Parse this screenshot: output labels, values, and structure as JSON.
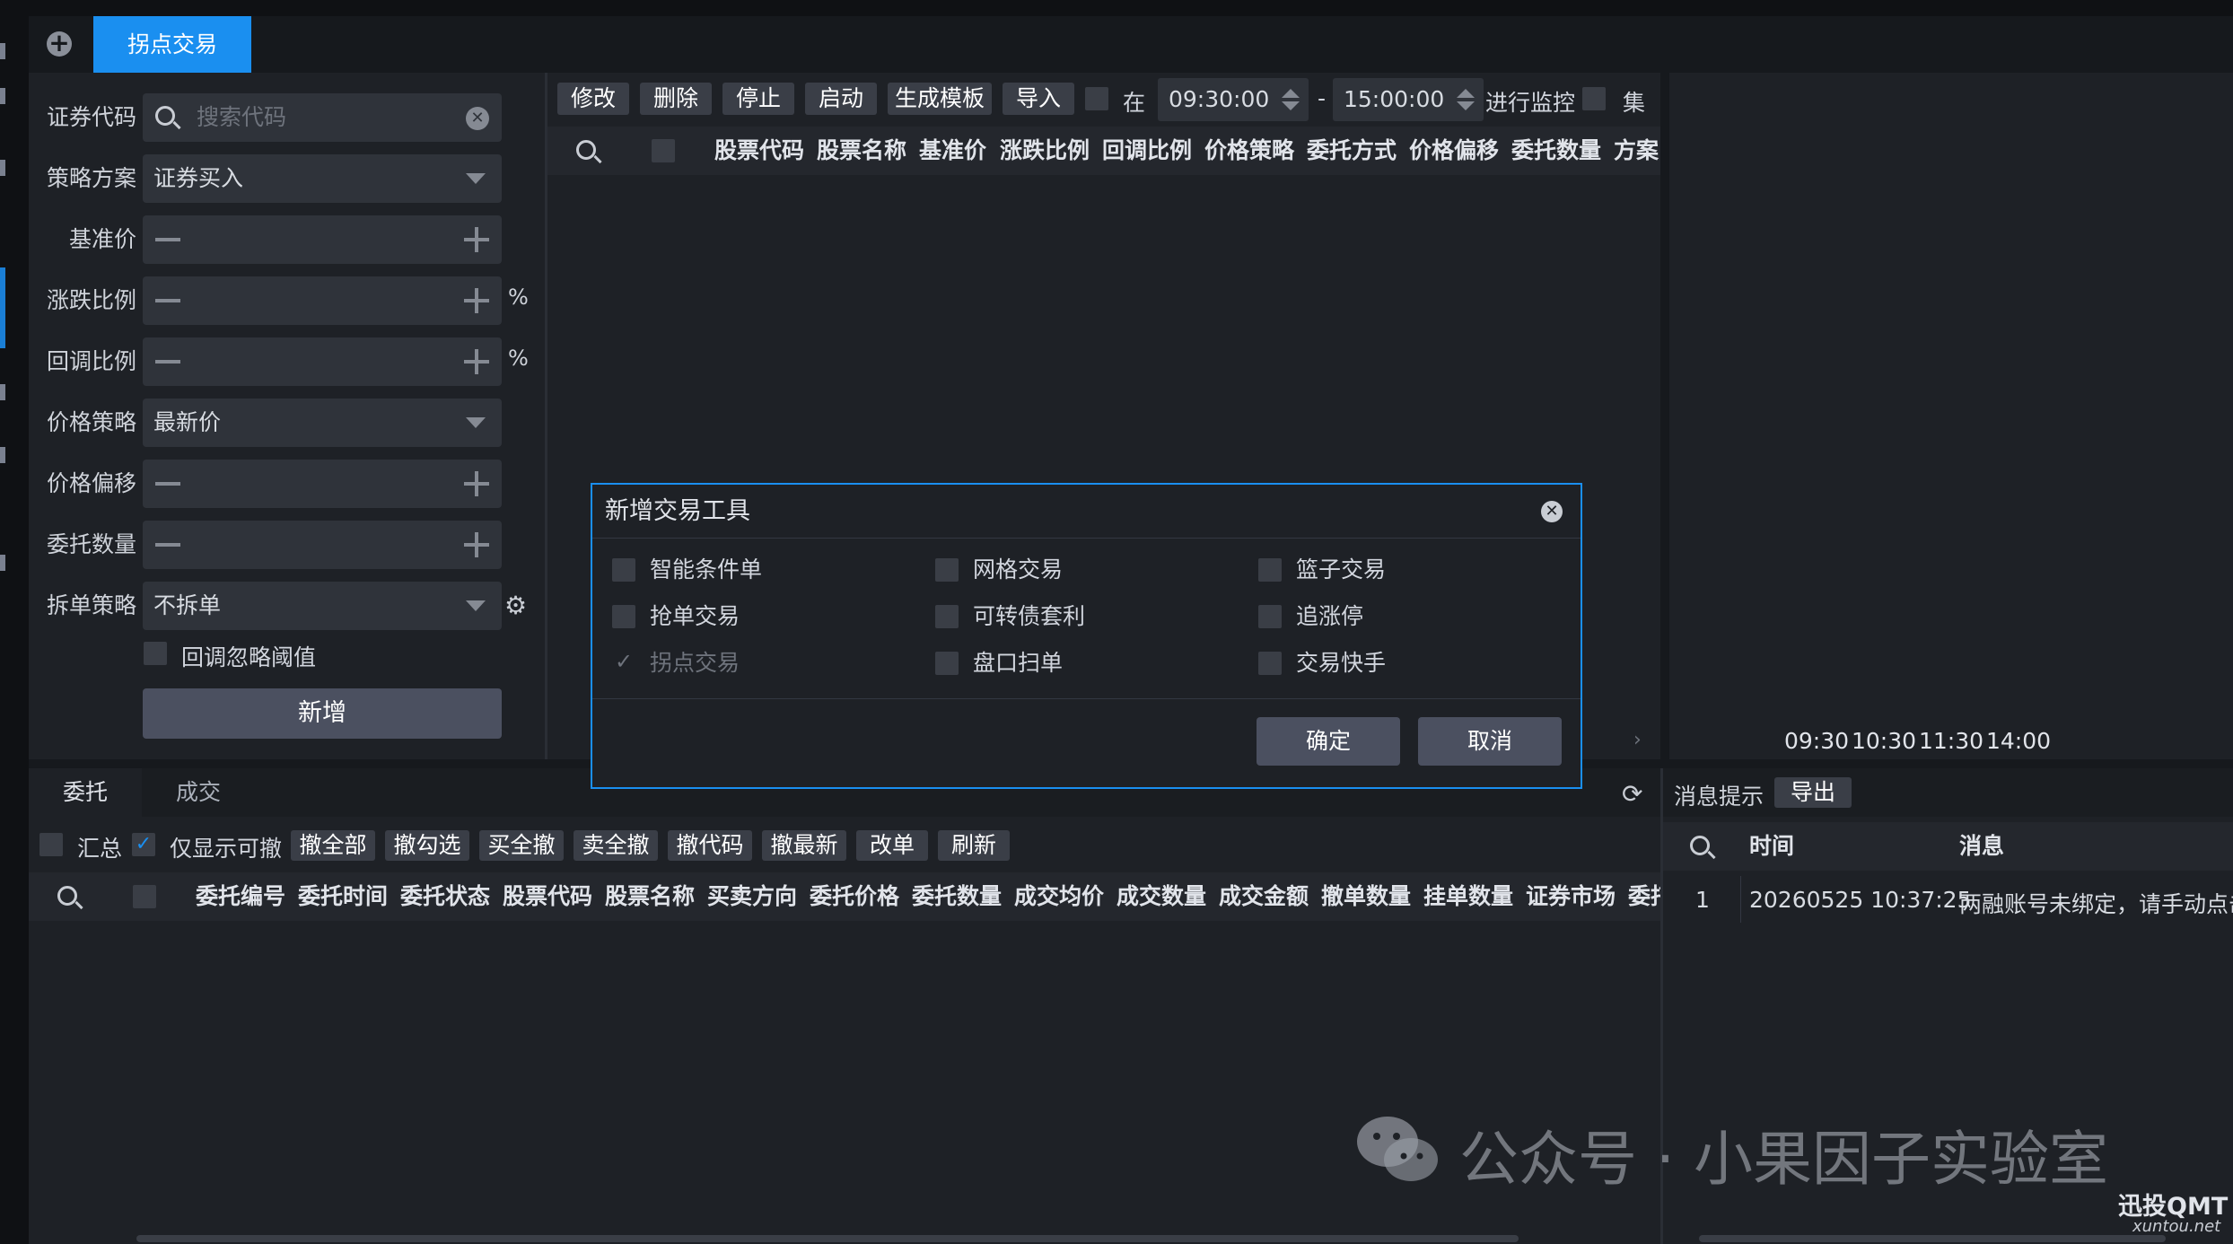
{
  "tabs": {
    "active": "拐点交易"
  },
  "form": {
    "security_code": {
      "label": "证券代码",
      "placeholder": "搜索代码"
    },
    "strategy_plan": {
      "label": "策略方案",
      "value": "证券买入"
    },
    "base_price": {
      "label": "基准价"
    },
    "change_ratio": {
      "label": "涨跌比例",
      "unit": "%"
    },
    "pullback_ratio": {
      "label": "回调比例",
      "unit": "%"
    },
    "price_strategy": {
      "label": "价格策略",
      "value": "最新价"
    },
    "price_offset": {
      "label": "价格偏移"
    },
    "order_qty": {
      "label": "委托数量"
    },
    "split_strategy": {
      "label": "拆单策略",
      "value": "不拆单"
    },
    "ignore_threshold": "回调忽略阈值",
    "add_button": "新增"
  },
  "toolbar": {
    "buttons": [
      "修改",
      "删除",
      "停止",
      "启动",
      "生成模板",
      "导入"
    ],
    "at_label": "在",
    "start_time": "09:30:00",
    "dash": "-",
    "end_time": "15:00:00",
    "monitor_label": "进行监控",
    "collect_label": "集"
  },
  "top_table": {
    "columns": [
      "股票代码",
      "股票名称",
      "基准价",
      "涨跌比例",
      "回调比例",
      "价格策略",
      "委托方式",
      "价格偏移",
      "委托数量",
      "方案"
    ]
  },
  "right_chart": {
    "time_axis": [
      "09:30",
      "10:30",
      "11:30",
      "14:00"
    ]
  },
  "dialog": {
    "title": "新增交易工具",
    "options": [
      [
        "智能条件单",
        "网格交易",
        "篮子交易"
      ],
      [
        "抢单交易",
        "可转债套利",
        "追涨停"
      ],
      [
        "拐点交易",
        "盘口扫单",
        "交易快手"
      ]
    ],
    "confirm": "确定",
    "cancel": "取消"
  },
  "bottom": {
    "tabs": [
      "委托",
      "成交"
    ],
    "summary_label": "汇总",
    "cancellable_only_label": "仅显示可撤",
    "actions": [
      "撤全部",
      "撤勾选",
      "买全撤",
      "卖全撤",
      "撤代码",
      "撤最新",
      "改单",
      "刷新"
    ],
    "columns": [
      "委托编号",
      "委托时间",
      "委托状态",
      "股票代码",
      "股票名称",
      "买卖方向",
      "委托价格",
      "委托数量",
      "成交均价",
      "成交数量",
      "成交金额",
      "撤单数量",
      "挂单数量",
      "证券市场",
      "委托"
    ]
  },
  "messages": {
    "title": "消息提示",
    "export": "导出",
    "columns": [
      "时间",
      "消息"
    ],
    "rows": [
      {
        "index": "1",
        "time": "20260525 10:37:25",
        "message": "两融账号未绑定，请手动点击"
      }
    ]
  },
  "watermark": {
    "text": "公众号 · 小果因子实验室",
    "brand": "迅投QMT",
    "site": "xuntou.net"
  },
  "colors": {
    "accent": "#1a8ff0",
    "background": "#1e2126",
    "button": "#3a3e47"
  }
}
